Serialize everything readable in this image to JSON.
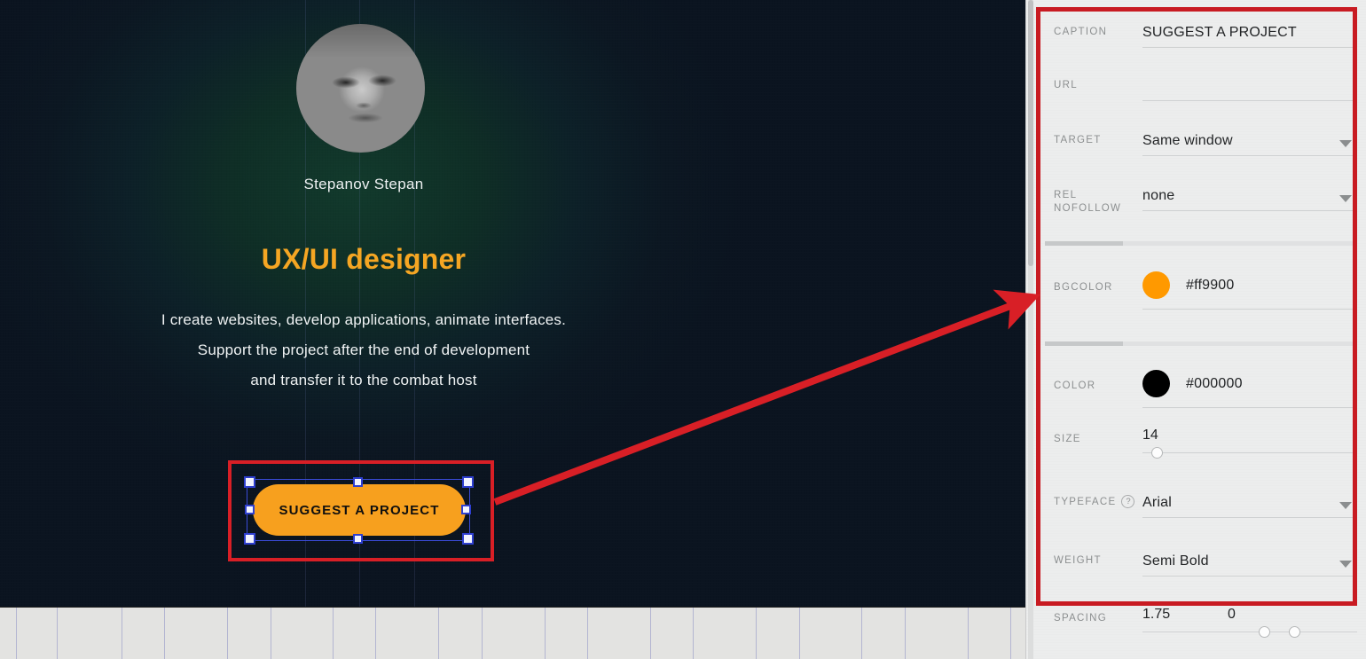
{
  "canvas": {
    "avatar_alt": "Stepanov Stepan portrait",
    "name": "Stepanov Stepan",
    "title": "UX/UI designer",
    "description": "I create websites, develop applications, animate interfaces.\nSupport the project after the end of development\nand transfer it to the combat host",
    "desc_lines": [
      "I create websites, develop applications, animate interfaces.",
      "Support the project after the end of development",
      "and transfer it to the combat host"
    ],
    "cta_button_label": "SUGGEST A PROJECT",
    "background_color": "#0b1420",
    "glow_color": "#123a2c",
    "accent_color": "#f5a623"
  },
  "annotation": {
    "highlight_color": "#c81b22",
    "arrow_color": "#d81f26",
    "selection_color": "#2e3fcf"
  },
  "panel": {
    "rows": {
      "caption": {
        "label": "CAPTION",
        "value": "SUGGEST A PROJECT",
        "placeholder": ""
      },
      "url": {
        "label": "URL",
        "value": "",
        "placeholder": ""
      },
      "target": {
        "label": "TARGET",
        "value": "Same window"
      },
      "rel_nofollow": {
        "label": "REL NOFOLLOW",
        "label_line1": "REL",
        "label_line2": "NOFOLLOW",
        "value": "none"
      },
      "bgcolor": {
        "label": "BGCOLOR",
        "value": "#ff9900",
        "swatch": "#ff9900"
      },
      "color": {
        "label": "COLOR",
        "value": "#000000",
        "swatch": "#000000"
      },
      "size": {
        "label": "SIZE",
        "value": "14",
        "knob_pct": 6
      },
      "typeface": {
        "label": "TYPEFACE",
        "value": "Arial",
        "help": "?"
      },
      "weight": {
        "label": "WEIGHT",
        "value": "Semi Bold"
      },
      "spacing": {
        "label": "SPACING",
        "value1": "1.75",
        "value2": "0",
        "knob1_pct": 54,
        "knob2_pct": 68
      }
    }
  }
}
